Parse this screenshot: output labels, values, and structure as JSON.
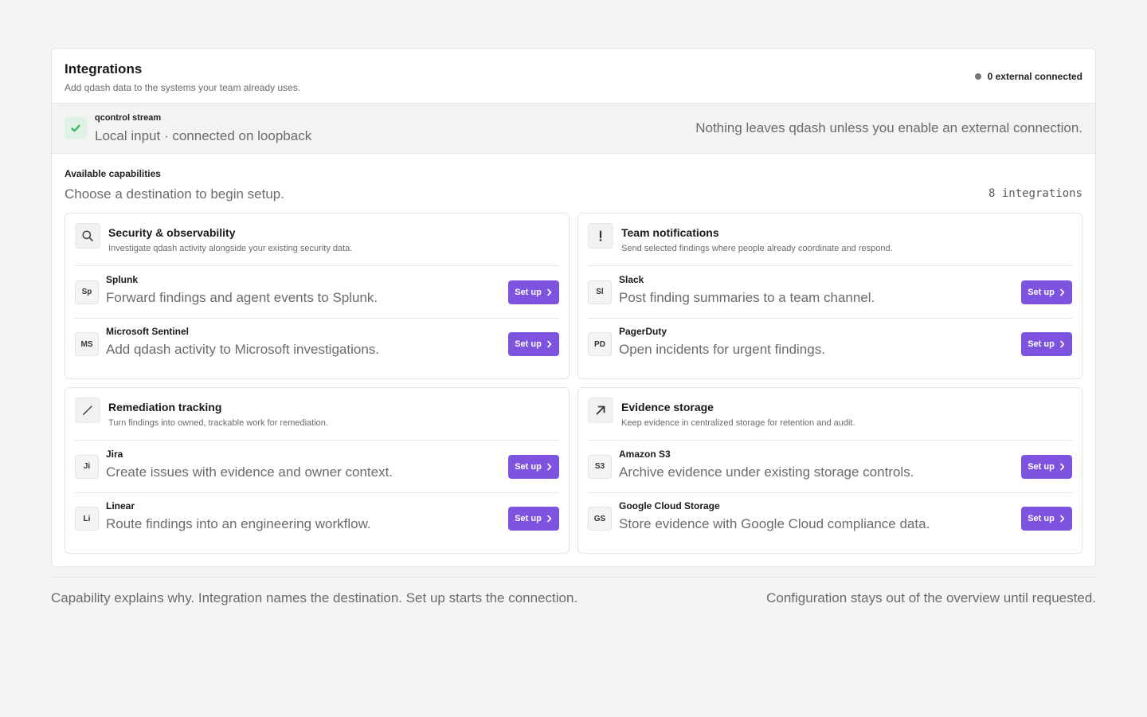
{
  "header": {
    "title": "Integrations",
    "subtitle": "Add qdash data to the systems your team already uses.",
    "status_text": "0 external connected"
  },
  "stream": {
    "name": "qcontrol stream",
    "detail": "Local input · connected on loopback",
    "note": "Nothing leaves qdash unless you enable an external connection."
  },
  "capabilities": {
    "label": "Available capabilities",
    "description": "Choose a destination to begin setup.",
    "count": "8 integrations",
    "cards": [
      {
        "icon": "search-icon",
        "title": "Security & observability",
        "description": "Investigate qdash activity alongside your existing security data.",
        "items": [
          {
            "abbr": "Sp",
            "name": "Splunk",
            "description": "Forward findings and agent events to Splunk.",
            "button": "Set up"
          },
          {
            "abbr": "MS",
            "name": "Microsoft Sentinel",
            "description": "Add qdash activity to Microsoft investigations.",
            "button": "Set up"
          }
        ]
      },
      {
        "icon": "exclamation-icon",
        "title": "Team notifications",
        "description": "Send selected findings where people already coordinate and respond.",
        "items": [
          {
            "abbr": "Sl",
            "name": "Slack",
            "description": "Post finding summaries to a team channel.",
            "button": "Set up"
          },
          {
            "abbr": "PD",
            "name": "PagerDuty",
            "description": "Open incidents for urgent findings.",
            "button": "Set up"
          }
        ]
      },
      {
        "icon": "pencil-icon",
        "title": "Remediation tracking",
        "description": "Turn findings into owned, trackable work for remediation.",
        "items": [
          {
            "abbr": "Ji",
            "name": "Jira",
            "description": "Create issues with evidence and owner context.",
            "button": "Set up"
          },
          {
            "abbr": "Li",
            "name": "Linear",
            "description": "Route findings into an engineering workflow.",
            "button": "Set up"
          }
        ]
      },
      {
        "icon": "arrow-up-right-icon",
        "title": "Evidence storage",
        "description": "Keep evidence in centralized storage for retention and audit.",
        "items": [
          {
            "abbr": "S3",
            "name": "Amazon S3",
            "description": "Archive evidence under existing storage controls.",
            "button": "Set up"
          },
          {
            "abbr": "GS",
            "name": "Google Cloud Storage",
            "description": "Store evidence with Google Cloud compliance data.",
            "button": "Set up"
          }
        ]
      }
    ]
  },
  "footer": {
    "left": "Capability explains why. Integration names the destination. Set up starts the connection.",
    "right": "Configuration stays out of the overview until requested."
  },
  "colors": {
    "accent": "#7e53e0",
    "success": "#2fb35c",
    "status_dot": "#777777"
  }
}
